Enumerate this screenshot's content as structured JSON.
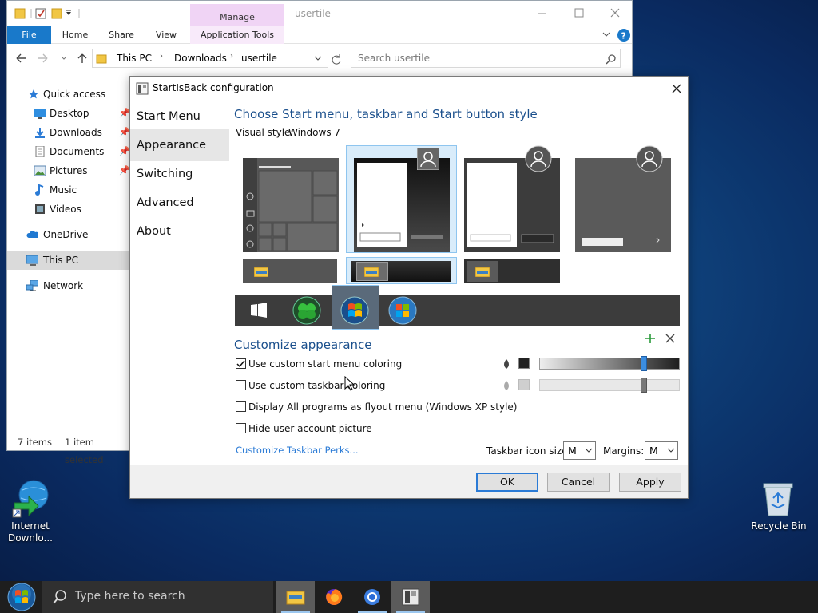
{
  "explorer": {
    "title": "usertile",
    "ribbon": {
      "file": "File",
      "home": "Home",
      "share": "Share",
      "view": "View",
      "manage": "Manage",
      "app_tools": "Application Tools"
    },
    "breadcrumb": [
      "This PC",
      "Downloads",
      "usertile"
    ],
    "search_placeholder": "Search usertile",
    "nav": {
      "quick_access": "Quick access",
      "desktop": "Desktop",
      "downloads": "Downloads",
      "documents": "Documents",
      "pictures": "Pictures",
      "music": "Music",
      "videos": "Videos",
      "onedrive": "OneDrive",
      "this_pc": "This PC",
      "network": "Network"
    },
    "status": {
      "items": "7 items",
      "selected": "1 item selected"
    }
  },
  "dialog": {
    "title": "StartIsBack configuration",
    "sidebar": [
      "Start Menu",
      "Appearance",
      "Switching",
      "Advanced",
      "About"
    ],
    "selected_section": "Appearance",
    "heading_style": "Choose Start menu, taskbar and Start button style",
    "visual_style_label": "Visual style:",
    "visual_style_value": "Windows 7",
    "heading_customize": "Customize appearance",
    "options": [
      {
        "label": "Use custom start menu coloring",
        "checked": true
      },
      {
        "label": "Use custom taskbar coloring",
        "checked": false
      },
      {
        "label": "Display All programs as flyout menu (Windows XP style)",
        "checked": false
      },
      {
        "label": "Hide user account picture",
        "checked": false
      }
    ],
    "start_menu_slider": 0.76,
    "taskbar_slider": 0.76,
    "colors": {
      "start_menu_swatch": "#222222",
      "taskbar_swatch": "#cfcfcf",
      "accent": "#1a4f8c"
    },
    "perks_link": "Customize Taskbar Perks...",
    "icon_size_label": "Taskbar icon size:",
    "icon_size_value": "M",
    "margins_label": "Margins:",
    "margins_value": "M",
    "buttons": {
      "ok": "OK",
      "cancel": "Cancel",
      "apply": "Apply"
    }
  },
  "desktop": {
    "icons": [
      {
        "label": "Internet Downlo..."
      },
      {
        "label": "Recycle Bin"
      }
    ]
  },
  "taskbar": {
    "search_placeholder": "Type here to search"
  }
}
